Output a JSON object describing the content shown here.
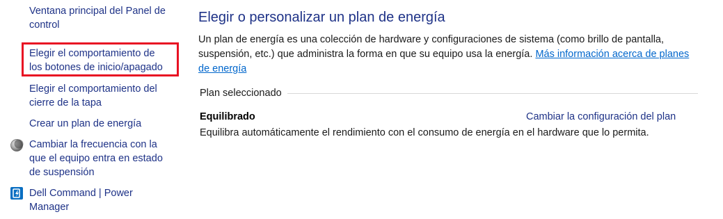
{
  "sidebar": {
    "items": [
      {
        "lines": [
          "Ventana principal del Panel de",
          "control"
        ]
      },
      {
        "lines": [
          "Elegir el comportamiento de",
          "los botones de inicio/apagado"
        ]
      },
      {
        "lines": [
          "Elegir el comportamiento del",
          "cierre de la tapa"
        ]
      },
      {
        "lines": [
          "Crear un plan de energía"
        ]
      },
      {
        "lines": [
          "Cambiar la frecuencia con la",
          "que el equipo entra en estado",
          "de suspensión"
        ],
        "icon": "moon-icon"
      },
      {
        "lines": [
          "Dell Command | Power",
          "Manager"
        ],
        "icon": "dell-command-icon"
      }
    ],
    "highlight_color": "#e81123"
  },
  "main": {
    "title": "Elegir o personalizar un plan de energía",
    "description_text": "Un plan de energía es una colección de hardware y configuraciones de sistema (como brillo de pantalla, suspensión, etc.) que administra la forma en que su equipo usa la energía. ",
    "description_link": "Más información acerca de planes de energía",
    "section_label": "Plan seleccionado",
    "plan": {
      "name": "Equilibrado",
      "change_link": "Cambiar la configuración del plan",
      "description": "Equilibra automáticamente el rendimiento con el consumo de energía en el hardware que lo permita."
    }
  },
  "colors": {
    "link": "#1e3287",
    "hyperlink": "#0066cc",
    "text": "#1a1a1a"
  }
}
